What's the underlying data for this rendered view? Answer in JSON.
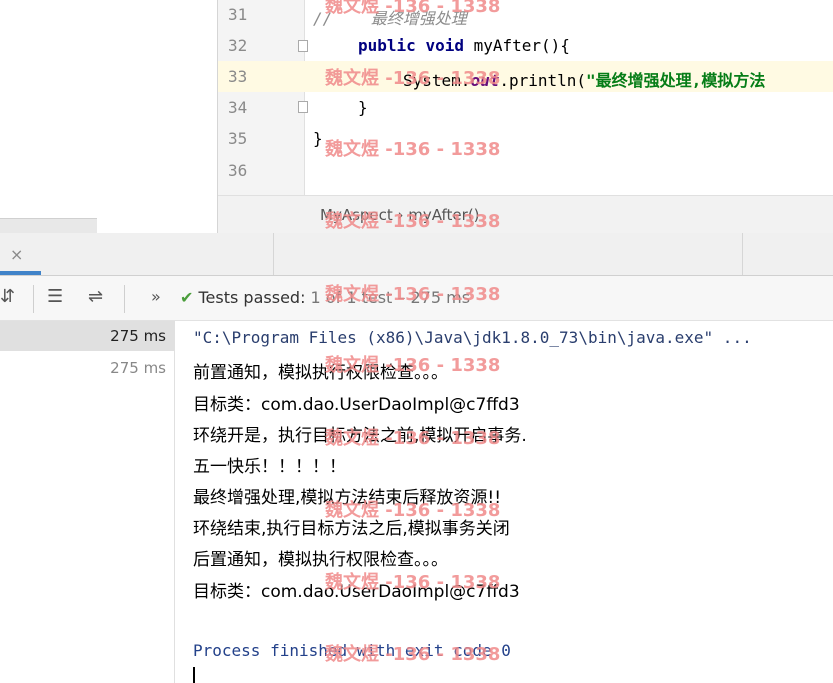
{
  "editor": {
    "line_numbers": [
      "31",
      "32",
      "33",
      "34",
      "35",
      "36"
    ],
    "line31_comment": "//    最终增强处理",
    "line32_kw1": "public",
    "line32_kw2": "void",
    "line32_rest": " myAfter(){",
    "line33_pre": "System.",
    "line33_field": "out",
    "line33_mid": ".println(",
    "line33_str": "\"最终增强处理,模拟方法",
    "line34": "}",
    "line35": "}",
    "breadcrumb": "MyAspect  ›  myAfter()"
  },
  "toolbar": {
    "more": "»",
    "check": "✔",
    "tests_passed": "Tests passed:",
    "count": " 1 of 1 test – 275 ms"
  },
  "tab": {
    "close": "×"
  },
  "tree": {
    "rows": [
      {
        "time": "275 ms"
      },
      {
        "time": "275 ms"
      }
    ]
  },
  "console": {
    "lines": [
      "\"C:\\Program Files (x86)\\Java\\jdk1.8.0_73\\bin\\java.exe\" ...",
      "前置通知，模拟执行权限检查。。。",
      "目标类：com.dao.UserDaoImpl@c7ffd3",
      "环绕开是，执行目标方法之前,模拟开启事务.",
      "五一快乐！！！！！",
      "最终增强处理,模拟方法结束后释放资源!!",
      "环绕结束,执行目标方法之后,模拟事务关闭",
      "后置通知，模拟执行权限检查。。。",
      "目标类：com.dao.UserDaoImpl@c7ffd3"
    ],
    "exit": "Process finished with exit code 0"
  },
  "watermark": "魏文煜 -136 - 1338",
  "colors": {
    "accent": "#4083c9",
    "pass_green": "#4a9d3b",
    "watermark": "#f08a8a"
  }
}
